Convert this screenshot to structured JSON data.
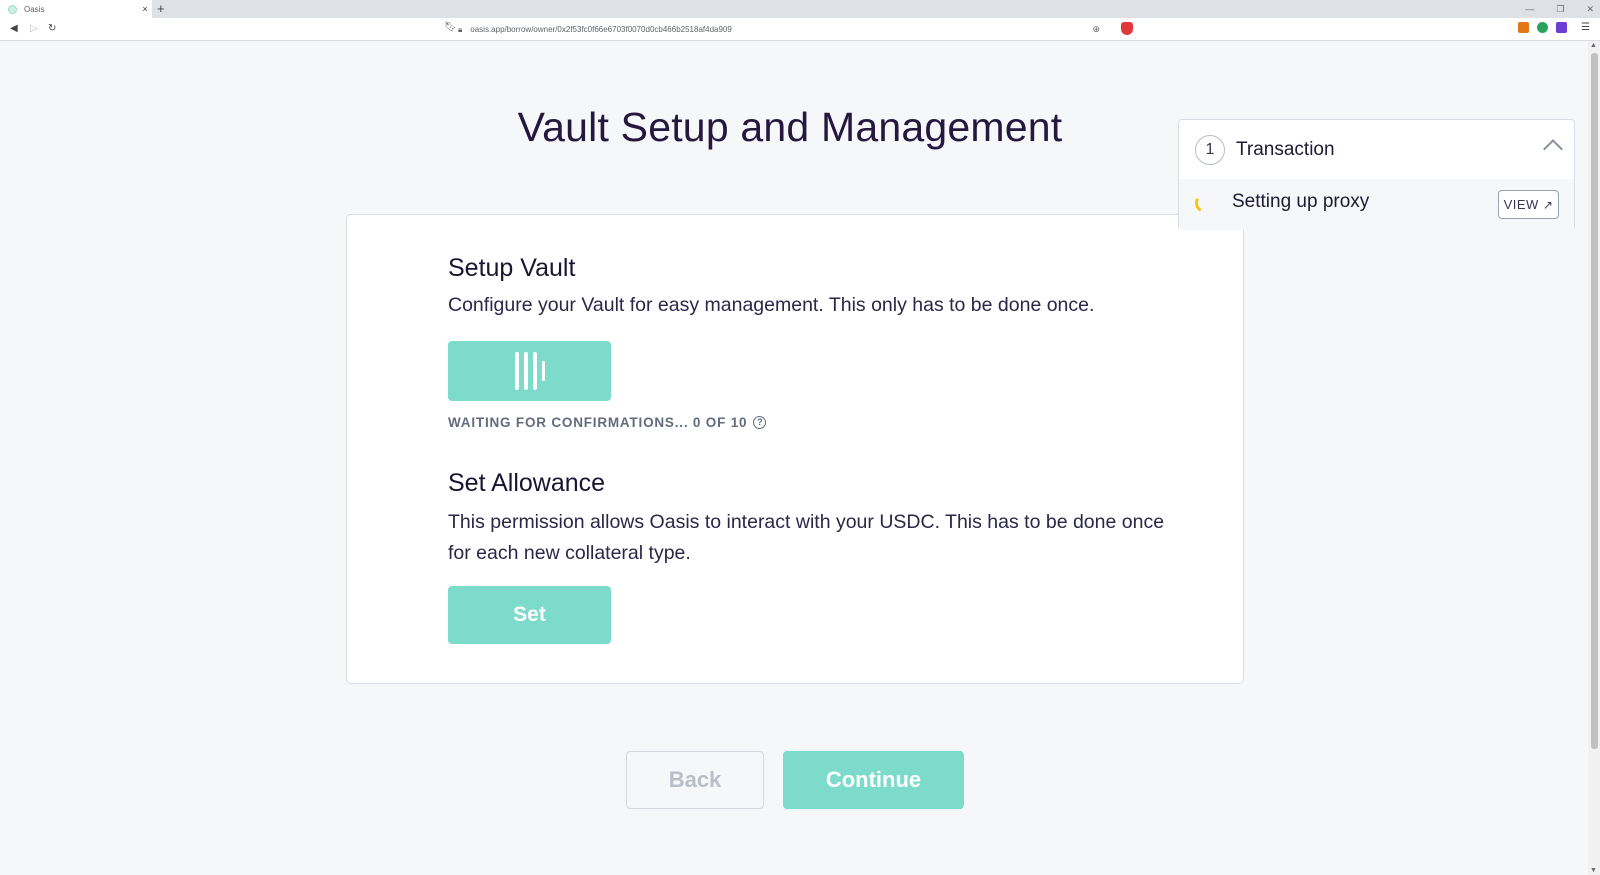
{
  "browser": {
    "tab_title": "Oasis",
    "tab_close": "×",
    "new_tab": "+",
    "url": "oasis.app/borrow/owner/0x2f53fc0f66e6703f0070d0cb466b2518af4da909",
    "icons": [
      "back-icon",
      "forward-icon",
      "reload-icon",
      "bookmark-icon",
      "lock-icon",
      "zoom-icon",
      "brave-shield-icon",
      "metamask-icon",
      "extension-green-icon",
      "extension-purple-icon",
      "menu-icon"
    ]
  },
  "page": {
    "title": "Vault Setup and Management"
  },
  "setup_vault": {
    "title": "Setup Vault",
    "description": "Configure your Vault for easy management. This only has to be done once.",
    "status": "WAITING FOR CONFIRMATIONS... 0 OF 10",
    "help_icon": "?"
  },
  "set_allowance": {
    "title": "Set Allowance",
    "description": "This permission allows Oasis to interact with your USDC. This has to be done once for each new collateral type.",
    "button_label": "Set"
  },
  "footer": {
    "back_label": "Back",
    "continue_label": "Continue"
  },
  "transaction_panel": {
    "count": "1",
    "title": "Transaction",
    "item_label": "Setting up proxy",
    "view_label": "VIEW",
    "view_icon": "↗"
  },
  "colors": {
    "accent": "#7ddbcb",
    "title": "#25183f",
    "spinner": "#f5c518"
  }
}
